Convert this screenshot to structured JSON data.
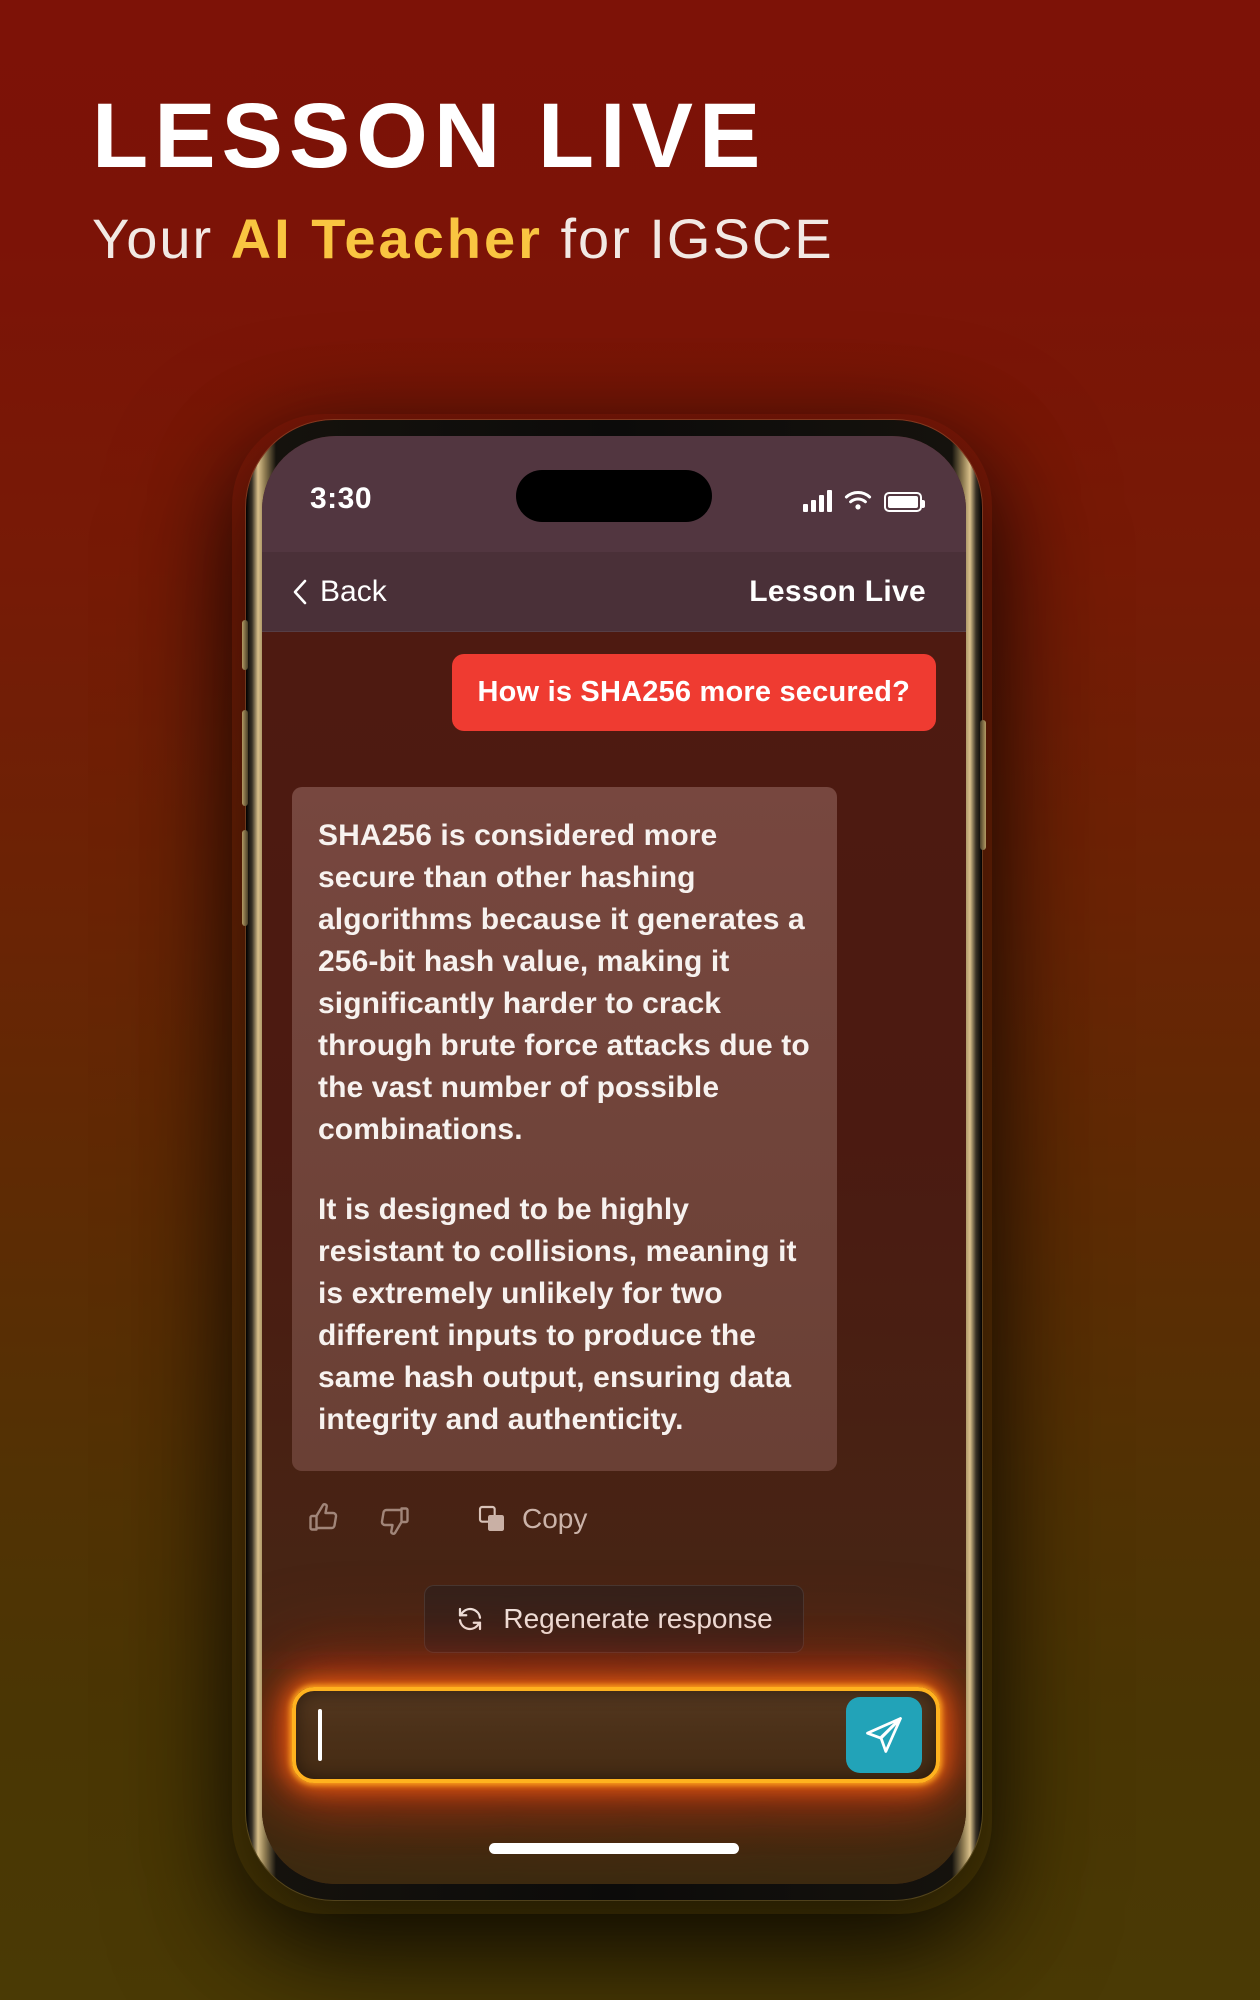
{
  "promo": {
    "headline": "LESSON LIVE",
    "subtitle_lead": "Your ",
    "subtitle_accent": "AI Teacher",
    "subtitle_tail": " for IGSCE",
    "accent_color": "#f9c541",
    "background_top": "#7d1207",
    "background_bottom": "#4a3a05"
  },
  "status_bar": {
    "time": "3:30",
    "signal_icon": "cellular-bars-icon",
    "wifi_icon": "wifi-icon",
    "battery_icon": "battery-full-icon"
  },
  "nav_bar": {
    "back_label": "Back",
    "back_icon": "chevron-left-icon",
    "title": "Lesson Live"
  },
  "chat": {
    "user_message": "How is SHA256 more secured?",
    "user_bubble_color": "#ef3b31",
    "assistant_paragraphs": [
      "SHA256 is considered more secure than other hashing algorithms because it generates a 256-bit hash value, making it significantly harder to crack through brute force attacks due to the vast number of possible combinations.",
      "It is designed to be highly resistant to collisions, meaning it is extremely unlikely for two different inputs to produce the same hash output, ensuring data integrity and authenticity."
    ]
  },
  "actions": {
    "thumbs_up_icon": "thumbs-up-icon",
    "thumbs_down_icon": "thumbs-down-icon",
    "copy_icon": "copy-icon",
    "copy_label": "Copy",
    "regenerate_icon": "refresh-icon",
    "regenerate_label": "Regenerate response"
  },
  "composer": {
    "input_value": "",
    "input_placeholder": "",
    "send_icon": "send-paper-plane-icon",
    "send_button_color": "#22a3b8",
    "glow_color": "#ffb21f"
  }
}
